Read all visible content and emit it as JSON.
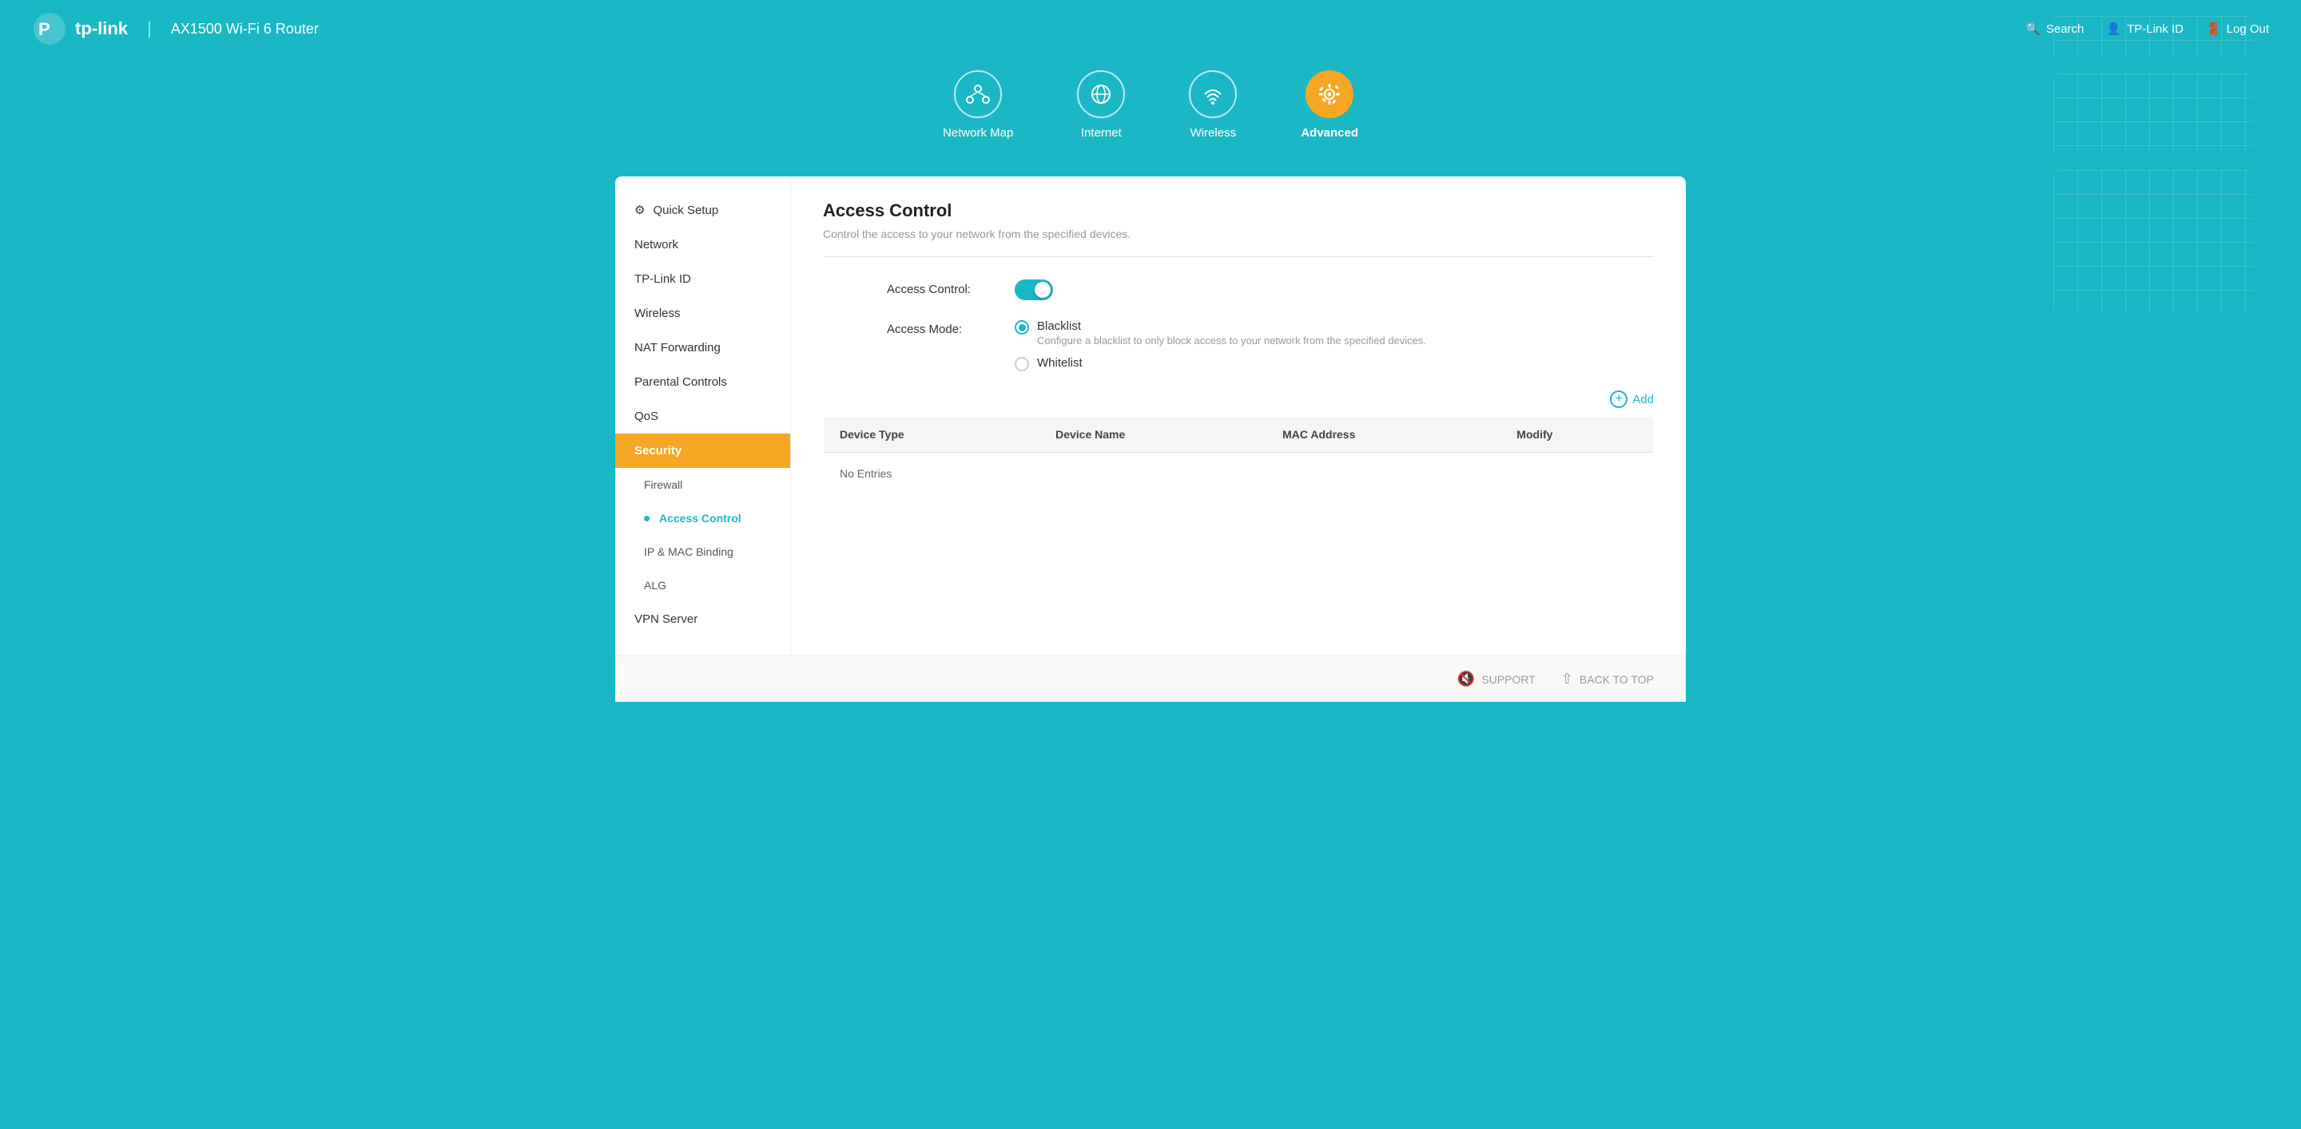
{
  "header": {
    "brand": "tp-link",
    "router_model": "AX1500 Wi-Fi 6 Router",
    "search_label": "Search",
    "tplink_id_label": "TP-Link ID",
    "logout_label": "Log Out"
  },
  "nav": {
    "tabs": [
      {
        "id": "network-map",
        "label": "Network Map",
        "active": false
      },
      {
        "id": "internet",
        "label": "Internet",
        "active": false
      },
      {
        "id": "wireless",
        "label": "Wireless",
        "active": false
      },
      {
        "id": "advanced",
        "label": "Advanced",
        "active": true
      }
    ]
  },
  "sidebar": {
    "items": [
      {
        "id": "quick-setup",
        "label": "Quick Setup",
        "icon": "gear",
        "type": "top"
      },
      {
        "id": "network",
        "label": "Network",
        "type": "top"
      },
      {
        "id": "tplink-id",
        "label": "TP-Link ID",
        "type": "top"
      },
      {
        "id": "wireless",
        "label": "Wireless",
        "type": "top"
      },
      {
        "id": "nat-forwarding",
        "label": "NAT Forwarding",
        "type": "top"
      },
      {
        "id": "parental-controls",
        "label": "Parental Controls",
        "type": "top"
      },
      {
        "id": "qos",
        "label": "QoS",
        "type": "top"
      },
      {
        "id": "security",
        "label": "Security",
        "type": "active-parent"
      },
      {
        "id": "firewall",
        "label": "Firewall",
        "type": "sub"
      },
      {
        "id": "access-control",
        "label": "Access Control",
        "type": "sub-active"
      },
      {
        "id": "ip-mac-binding",
        "label": "IP & MAC Binding",
        "type": "sub"
      },
      {
        "id": "alg",
        "label": "ALG",
        "type": "sub"
      },
      {
        "id": "vpn-server",
        "label": "VPN Server",
        "type": "top"
      }
    ]
  },
  "main": {
    "title": "Access Control",
    "description": "Control the access to your network from the specified devices.",
    "access_control_label": "Access Control:",
    "access_mode_label": "Access Mode:",
    "blacklist_label": "Blacklist",
    "blacklist_desc": "Configure a blacklist to only block access to your network from the specified devices.",
    "whitelist_label": "Whitelist",
    "add_label": "Add",
    "table": {
      "columns": [
        "Device Type",
        "Device Name",
        "MAC Address",
        "Modify"
      ],
      "empty_message": "No Entries"
    }
  },
  "footer": {
    "support_label": "SUPPORT",
    "back_to_top_label": "BACK TO TOP"
  }
}
